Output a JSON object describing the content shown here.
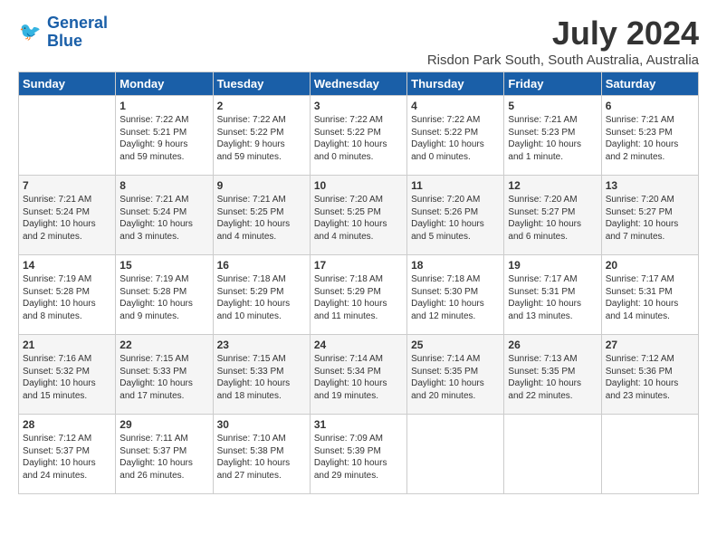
{
  "logo": {
    "line1": "General",
    "line2": "Blue"
  },
  "title": "July 2024",
  "subtitle": "Risdon Park South, South Australia, Australia",
  "days_of_week": [
    "Sunday",
    "Monday",
    "Tuesday",
    "Wednesday",
    "Thursday",
    "Friday",
    "Saturday"
  ],
  "weeks": [
    [
      {
        "day": "",
        "sunrise": "",
        "sunset": "",
        "daylight": ""
      },
      {
        "day": "1",
        "sunrise": "Sunrise: 7:22 AM",
        "sunset": "Sunset: 5:21 PM",
        "daylight": "Daylight: 9 hours and 59 minutes."
      },
      {
        "day": "2",
        "sunrise": "Sunrise: 7:22 AM",
        "sunset": "Sunset: 5:22 PM",
        "daylight": "Daylight: 9 hours and 59 minutes."
      },
      {
        "day": "3",
        "sunrise": "Sunrise: 7:22 AM",
        "sunset": "Sunset: 5:22 PM",
        "daylight": "Daylight: 10 hours and 0 minutes."
      },
      {
        "day": "4",
        "sunrise": "Sunrise: 7:22 AM",
        "sunset": "Sunset: 5:22 PM",
        "daylight": "Daylight: 10 hours and 0 minutes."
      },
      {
        "day": "5",
        "sunrise": "Sunrise: 7:21 AM",
        "sunset": "Sunset: 5:23 PM",
        "daylight": "Daylight: 10 hours and 1 minute."
      },
      {
        "day": "6",
        "sunrise": "Sunrise: 7:21 AM",
        "sunset": "Sunset: 5:23 PM",
        "daylight": "Daylight: 10 hours and 2 minutes."
      }
    ],
    [
      {
        "day": "7",
        "sunrise": "Sunrise: 7:21 AM",
        "sunset": "Sunset: 5:24 PM",
        "daylight": "Daylight: 10 hours and 2 minutes."
      },
      {
        "day": "8",
        "sunrise": "Sunrise: 7:21 AM",
        "sunset": "Sunset: 5:24 PM",
        "daylight": "Daylight: 10 hours and 3 minutes."
      },
      {
        "day": "9",
        "sunrise": "Sunrise: 7:21 AM",
        "sunset": "Sunset: 5:25 PM",
        "daylight": "Daylight: 10 hours and 4 minutes."
      },
      {
        "day": "10",
        "sunrise": "Sunrise: 7:20 AM",
        "sunset": "Sunset: 5:25 PM",
        "daylight": "Daylight: 10 hours and 4 minutes."
      },
      {
        "day": "11",
        "sunrise": "Sunrise: 7:20 AM",
        "sunset": "Sunset: 5:26 PM",
        "daylight": "Daylight: 10 hours and 5 minutes."
      },
      {
        "day": "12",
        "sunrise": "Sunrise: 7:20 AM",
        "sunset": "Sunset: 5:27 PM",
        "daylight": "Daylight: 10 hours and 6 minutes."
      },
      {
        "day": "13",
        "sunrise": "Sunrise: 7:20 AM",
        "sunset": "Sunset: 5:27 PM",
        "daylight": "Daylight: 10 hours and 7 minutes."
      }
    ],
    [
      {
        "day": "14",
        "sunrise": "Sunrise: 7:19 AM",
        "sunset": "Sunset: 5:28 PM",
        "daylight": "Daylight: 10 hours and 8 minutes."
      },
      {
        "day": "15",
        "sunrise": "Sunrise: 7:19 AM",
        "sunset": "Sunset: 5:28 PM",
        "daylight": "Daylight: 10 hours and 9 minutes."
      },
      {
        "day": "16",
        "sunrise": "Sunrise: 7:18 AM",
        "sunset": "Sunset: 5:29 PM",
        "daylight": "Daylight: 10 hours and 10 minutes."
      },
      {
        "day": "17",
        "sunrise": "Sunrise: 7:18 AM",
        "sunset": "Sunset: 5:29 PM",
        "daylight": "Daylight: 10 hours and 11 minutes."
      },
      {
        "day": "18",
        "sunrise": "Sunrise: 7:18 AM",
        "sunset": "Sunset: 5:30 PM",
        "daylight": "Daylight: 10 hours and 12 minutes."
      },
      {
        "day": "19",
        "sunrise": "Sunrise: 7:17 AM",
        "sunset": "Sunset: 5:31 PM",
        "daylight": "Daylight: 10 hours and 13 minutes."
      },
      {
        "day": "20",
        "sunrise": "Sunrise: 7:17 AM",
        "sunset": "Sunset: 5:31 PM",
        "daylight": "Daylight: 10 hours and 14 minutes."
      }
    ],
    [
      {
        "day": "21",
        "sunrise": "Sunrise: 7:16 AM",
        "sunset": "Sunset: 5:32 PM",
        "daylight": "Daylight: 10 hours and 15 minutes."
      },
      {
        "day": "22",
        "sunrise": "Sunrise: 7:15 AM",
        "sunset": "Sunset: 5:33 PM",
        "daylight": "Daylight: 10 hours and 17 minutes."
      },
      {
        "day": "23",
        "sunrise": "Sunrise: 7:15 AM",
        "sunset": "Sunset: 5:33 PM",
        "daylight": "Daylight: 10 hours and 18 minutes."
      },
      {
        "day": "24",
        "sunrise": "Sunrise: 7:14 AM",
        "sunset": "Sunset: 5:34 PM",
        "daylight": "Daylight: 10 hours and 19 minutes."
      },
      {
        "day": "25",
        "sunrise": "Sunrise: 7:14 AM",
        "sunset": "Sunset: 5:35 PM",
        "daylight": "Daylight: 10 hours and 20 minutes."
      },
      {
        "day": "26",
        "sunrise": "Sunrise: 7:13 AM",
        "sunset": "Sunset: 5:35 PM",
        "daylight": "Daylight: 10 hours and 22 minutes."
      },
      {
        "day": "27",
        "sunrise": "Sunrise: 7:12 AM",
        "sunset": "Sunset: 5:36 PM",
        "daylight": "Daylight: 10 hours and 23 minutes."
      }
    ],
    [
      {
        "day": "28",
        "sunrise": "Sunrise: 7:12 AM",
        "sunset": "Sunset: 5:37 PM",
        "daylight": "Daylight: 10 hours and 24 minutes."
      },
      {
        "day": "29",
        "sunrise": "Sunrise: 7:11 AM",
        "sunset": "Sunset: 5:37 PM",
        "daylight": "Daylight: 10 hours and 26 minutes."
      },
      {
        "day": "30",
        "sunrise": "Sunrise: 7:10 AM",
        "sunset": "Sunset: 5:38 PM",
        "daylight": "Daylight: 10 hours and 27 minutes."
      },
      {
        "day": "31",
        "sunrise": "Sunrise: 7:09 AM",
        "sunset": "Sunset: 5:39 PM",
        "daylight": "Daylight: 10 hours and 29 minutes."
      },
      {
        "day": "",
        "sunrise": "",
        "sunset": "",
        "daylight": ""
      },
      {
        "day": "",
        "sunrise": "",
        "sunset": "",
        "daylight": ""
      },
      {
        "day": "",
        "sunrise": "",
        "sunset": "",
        "daylight": ""
      }
    ]
  ]
}
